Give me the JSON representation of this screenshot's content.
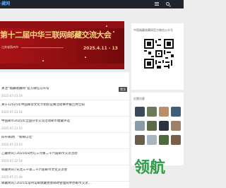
{
  "header": {
    "logo_text": "·藏网",
    "menu_icon": "menu-icon",
    "search_icon": "search-icon",
    "bg": "#1f252b"
  },
  "banner": {
    "title": "第十二届中华三联网邮藏交流大会",
    "place": "江苏省扬州市",
    "date": "2025.4.11 - 13"
  },
  "articles": [
    {
      "title": "关注“福藏收藏网”官方微信公众号",
      "date": "2025-07-23 19",
      "badge": "置顶"
    },
    {
      "title": "关于12025年中国邮票文化节组织竞赛活动事件报告并告知",
      "date": "2025-07-23 18",
      "badge": ""
    },
    {
      "title": "中国邮币2025年全国分享交流活动邮币收藏评选",
      "date": "2025-07-23 10",
      "badge": ""
    },
    {
      "title": "四平邮政厂“和掉以北”",
      "date": "2025-07-23 10",
      "badge": ""
    },
    {
      "title": "乙藏简讯] 2025年8月在三河重二十六届邮币交流活动",
      "date": "2025-07-22 18",
      "badge": ""
    },
    {
      "title": "邮藏简讯] 先北三十第二十六届邮币文化交流会",
      "date": "2025-07-21 09",
      "badge": ""
    },
    {
      "title": "邮藏简讯] 2025年常州常邮收藏协会邮政管理局举办邮币交流...",
      "date": "2025-07-21 08",
      "badge": ""
    }
  ],
  "sidebar": {
    "qr_title": "中国福藏收藏网官方微信公众号",
    "visitors_title": "近期访客",
    "watermark": "领航"
  },
  "colors": {
    "accent": "#4aa3ff",
    "banner": "#8f0f12",
    "gold": "#f6d67c",
    "watermark": "#2d9c48"
  }
}
